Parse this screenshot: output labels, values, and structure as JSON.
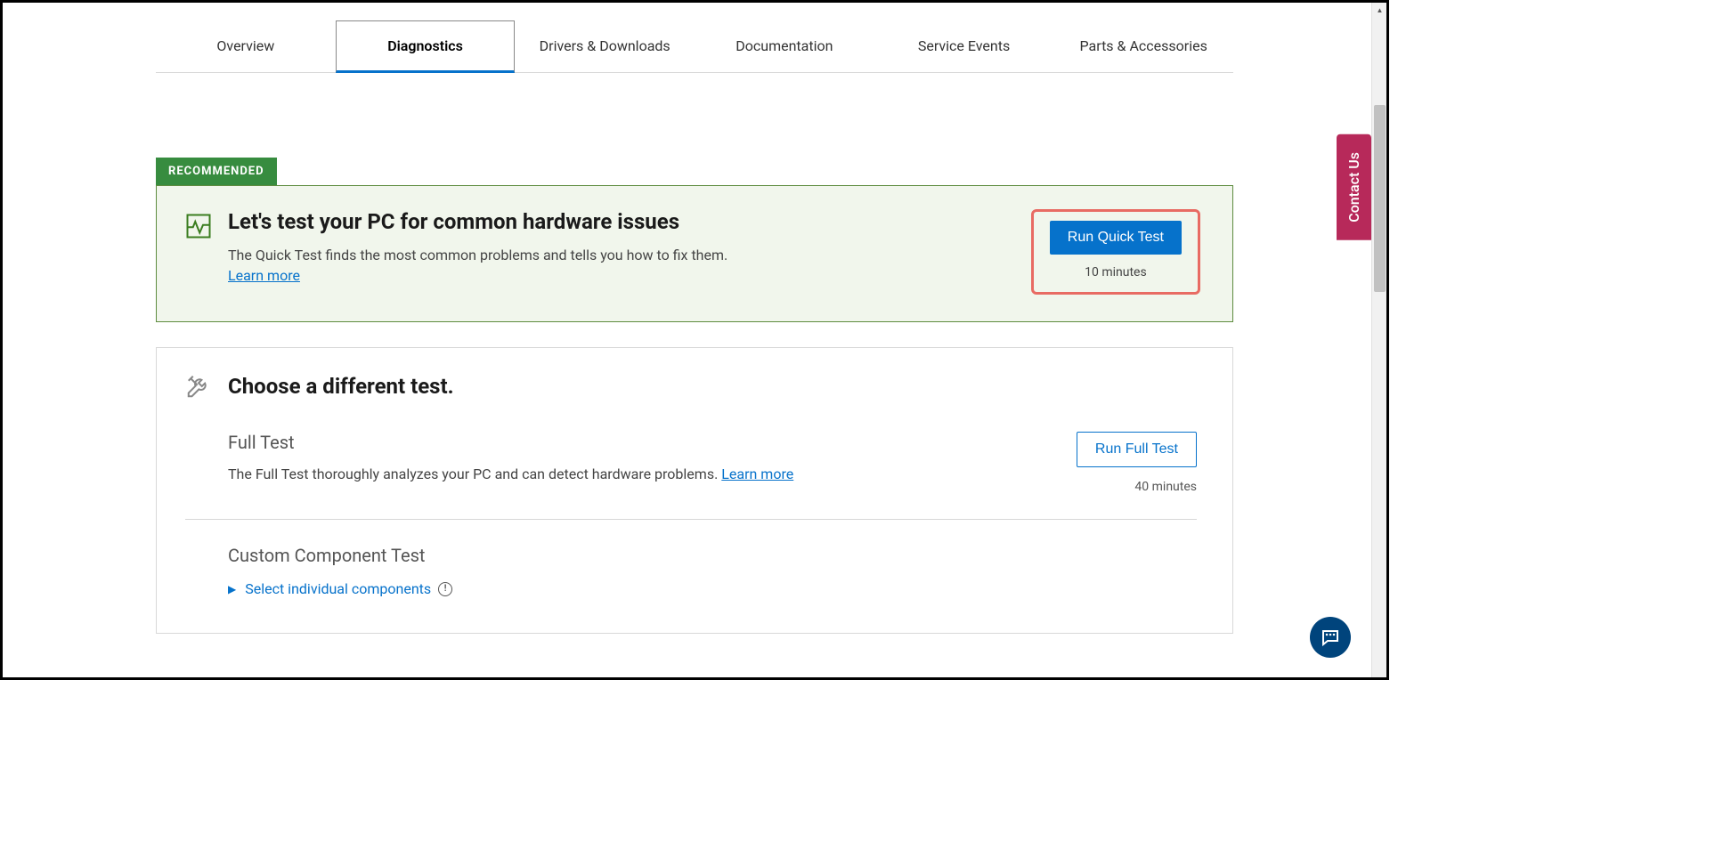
{
  "tabs": {
    "overview": "Overview",
    "diagnostics": "Diagnostics",
    "drivers": "Drivers & Downloads",
    "documentation": "Documentation",
    "service_events": "Service Events",
    "parts": "Parts & Accessories"
  },
  "recommended": {
    "badge": "RECOMMENDED",
    "title": "Let's test your PC for common hardware issues",
    "description": "The Quick Test finds the most common problems and tells you how to fix them.",
    "learn_more": "Learn more",
    "button": "Run Quick Test",
    "duration": "10 minutes"
  },
  "choose_different": {
    "title": "Choose a different test."
  },
  "full_test": {
    "name": "Full Test",
    "description": "The Full Test thoroughly analyzes your PC and can detect hardware problems. ",
    "learn_more": "Learn more",
    "button": "Run Full Test",
    "duration": "40 minutes"
  },
  "custom_test": {
    "name": "Custom Component Test",
    "select_link": "Select individual components"
  },
  "contact_us": "Contact Us"
}
